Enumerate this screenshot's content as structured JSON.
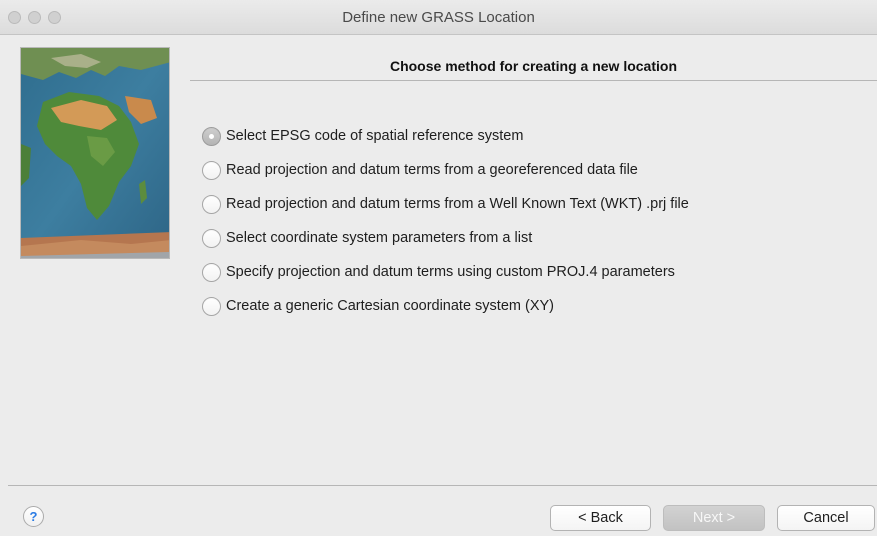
{
  "window": {
    "title": "Define new GRASS Location"
  },
  "header": {
    "title": "Choose method for creating a new location"
  },
  "options": [
    {
      "label": "Select EPSG code of spatial reference system",
      "selected": true
    },
    {
      "label": "Read projection and datum terms from a georeferenced data file",
      "selected": false
    },
    {
      "label": "Read projection and datum terms from a Well Known Text (WKT) .prj file",
      "selected": false
    },
    {
      "label": "Select coordinate system parameters from a list",
      "selected": false
    },
    {
      "label": "Specify projection and datum terms using custom PROJ.4 parameters",
      "selected": false
    },
    {
      "label": "Create a generic Cartesian coordinate system (XY)",
      "selected": false
    }
  ],
  "footer": {
    "help_label": "?",
    "back_label": "< Back",
    "next_label": "Next >",
    "cancel_label": "Cancel"
  },
  "icons": {
    "help": "help-icon",
    "map": "world-map-image"
  },
  "colors": {
    "help_accent": "#2a7be4",
    "disabled_button": "#c8c8c8"
  }
}
